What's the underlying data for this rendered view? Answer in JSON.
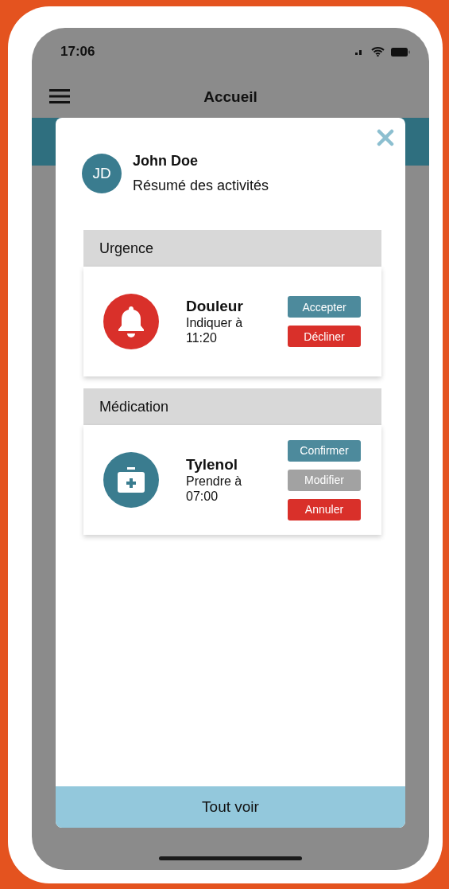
{
  "status_bar": {
    "time": "17:06"
  },
  "nav_bar": {
    "title": "Accueil"
  },
  "modal": {
    "avatar_initials": "JD",
    "name": "John Doe",
    "subtitle": "Résumé des activités",
    "sections": [
      {
        "title": "Urgence",
        "items": [
          {
            "kind": "alert",
            "color": "#d9302a",
            "title": "Douleur",
            "detail": "Indiquer à 11:20",
            "buttons": [
              {
                "label": "Accepter",
                "kind": "primary",
                "disabled": false
              },
              {
                "label": "Décliner",
                "kind": "danger",
                "disabled": false
              }
            ]
          }
        ]
      },
      {
        "title": "Médication",
        "items": [
          {
            "kind": "medication",
            "color": "#3a7c8f",
            "title": "Tylenol",
            "detail": "Prendre à 07:00",
            "buttons": [
              {
                "label": "Confirmer",
                "kind": "primary",
                "disabled": false
              },
              {
                "label": "Modifier",
                "kind": "primary",
                "disabled": true
              },
              {
                "label": "Annuler",
                "kind": "danger",
                "disabled": false
              }
            ]
          }
        ]
      }
    ],
    "footer_button": "Tout voir"
  }
}
